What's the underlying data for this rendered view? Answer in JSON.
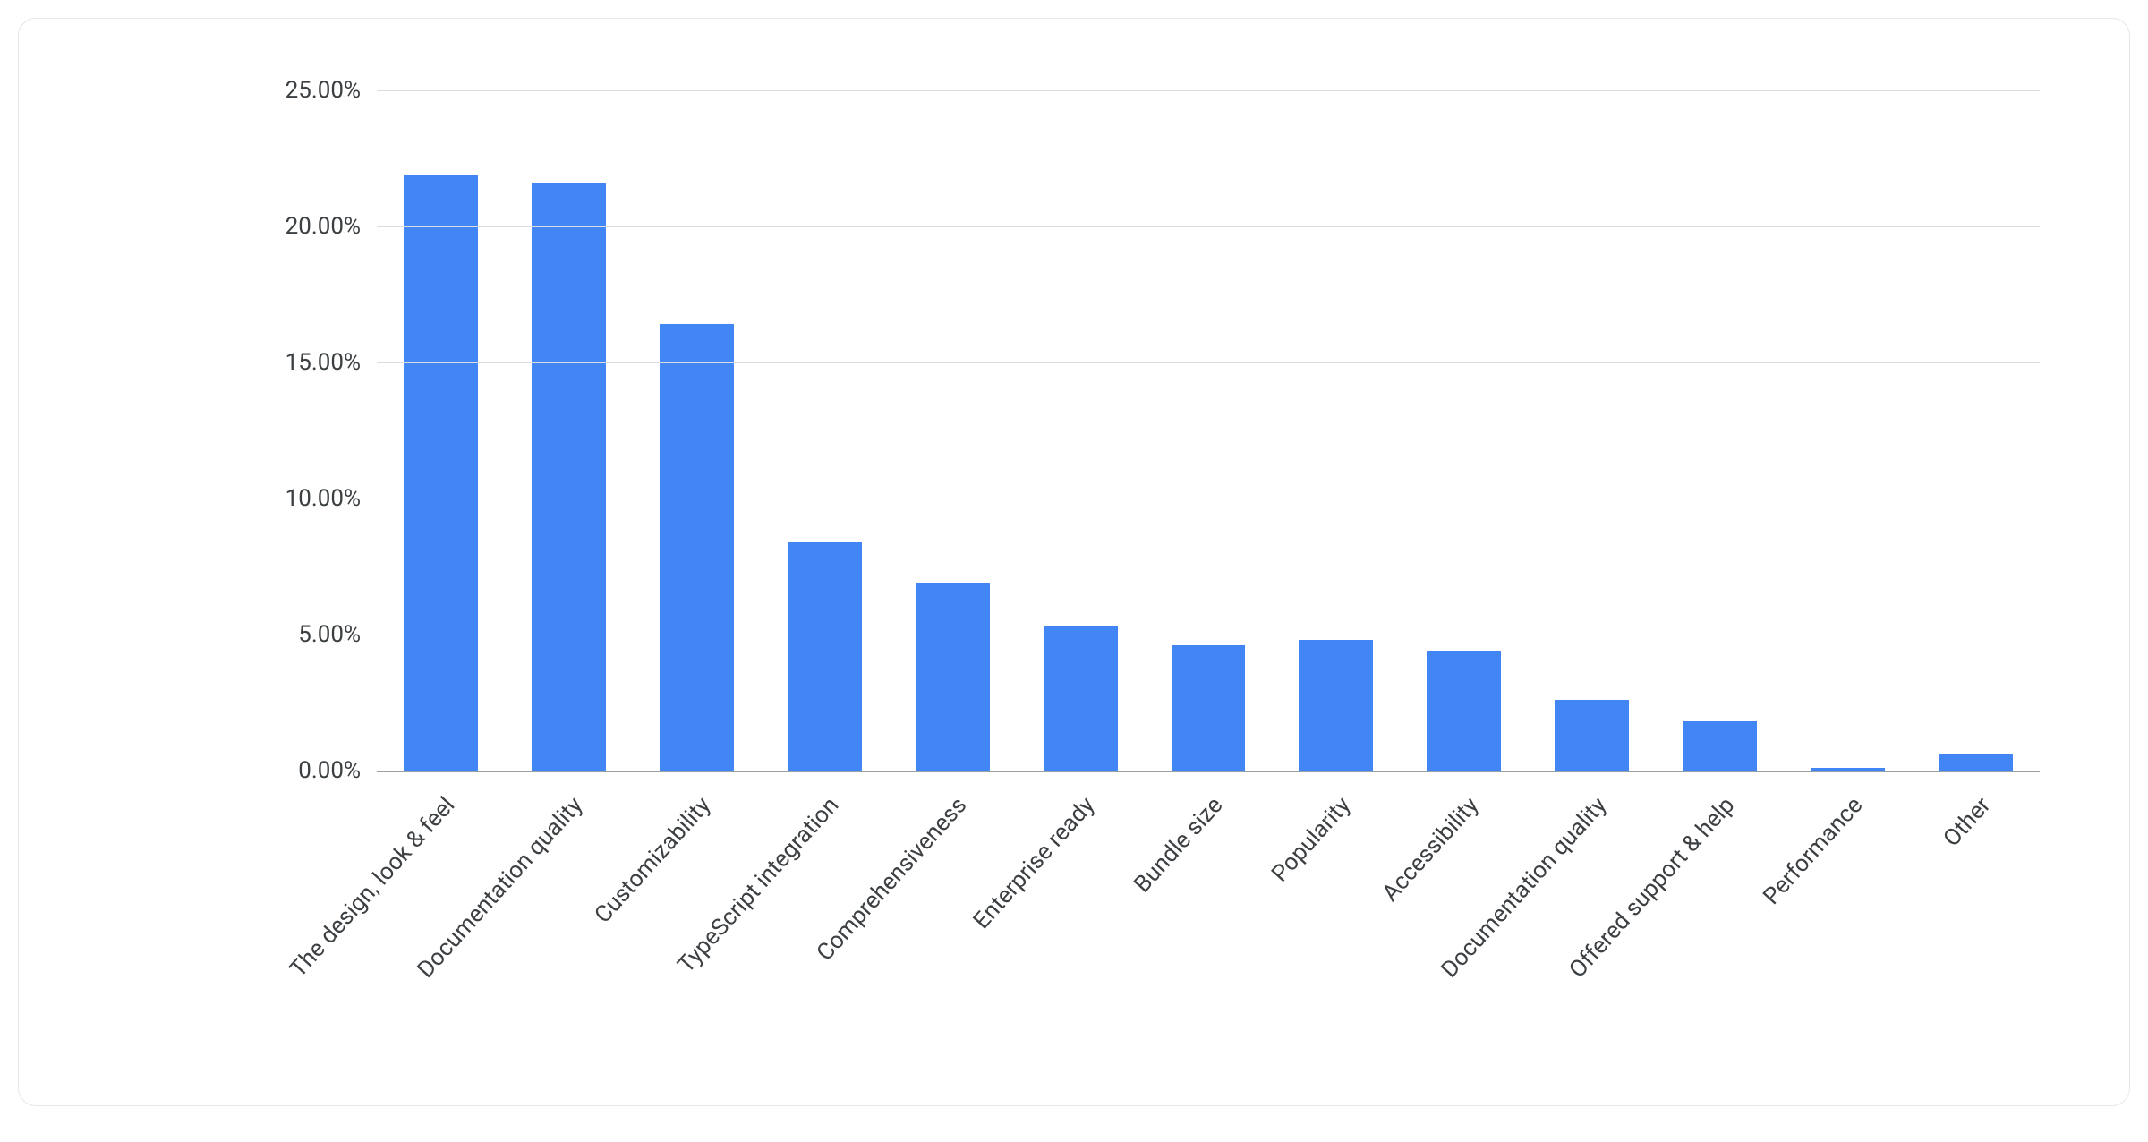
{
  "chart_data": {
    "type": "bar",
    "title": "",
    "xlabel": "",
    "ylabel": "",
    "ylim": [
      0,
      25
    ],
    "y_ticks": [
      0,
      5,
      10,
      15,
      20,
      25
    ],
    "y_tick_labels": [
      "0.00%",
      "5.00%",
      "10.00%",
      "15.00%",
      "20.00%",
      "25.00%"
    ],
    "categories": [
      "The design, look & feel",
      "Documentation quality",
      "Customizability",
      "TypeScript integration",
      "Comprehensiveness",
      "Enterprise ready",
      "Bundle size",
      "Popularity",
      "Accessibility",
      "Documentation quality",
      "Offered support & help",
      "Performance",
      "Other"
    ],
    "values": [
      21.9,
      21.6,
      16.4,
      8.4,
      6.9,
      5.3,
      4.6,
      4.8,
      4.4,
      2.6,
      1.8,
      0.1,
      0.6
    ],
    "bar_color": "#4285f4",
    "grid_color": "#dadce0"
  }
}
